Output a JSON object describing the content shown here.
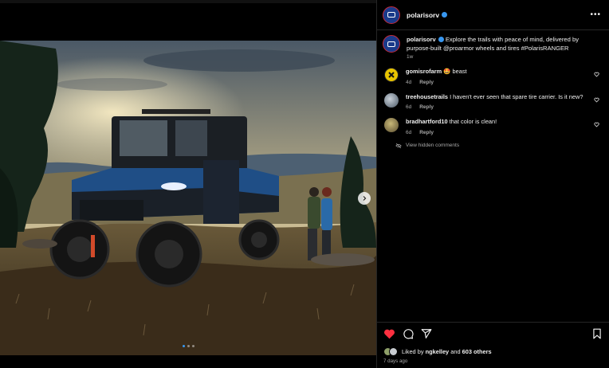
{
  "post": {
    "username": "polarisorv",
    "caption_user": "polarisorv",
    "caption_text": "Explore the trails with peace of mind, delivered by purpose-built @proarmor wheels and tires #PolarisRANGER",
    "caption_time": "1w"
  },
  "comments": [
    {
      "user": "gomisrofarm",
      "text": "🤩 beast",
      "time": "4d",
      "reply": "Reply",
      "avatar_color": "#e8c400"
    },
    {
      "user": "treehousetrails",
      "text": "I haven't ever seen that spare tire carrier. Is it new?",
      "time": "6d",
      "reply": "Reply",
      "avatar_color": "#7a8a9a"
    },
    {
      "user": "bradhartford10",
      "text": "that color is clean!",
      "time": "6d",
      "reply": "Reply",
      "avatar_color": "#8a8050"
    }
  ],
  "view_hidden": "View hidden comments",
  "likes": {
    "prefix": "Liked by ",
    "user": "ngkelley",
    "middle": " and ",
    "others": "603 others",
    "time": "7 days ago"
  },
  "colors": {
    "like_red": "#ff3040",
    "link_blue": "#3897f0",
    "muted": "#a8a8a8"
  },
  "icons": [
    "verified-badge-icon",
    "more-options-icon",
    "heart-icon",
    "comment-icon",
    "share-icon",
    "bookmark-icon",
    "next-arrow-icon",
    "hidden-comments-icon"
  ]
}
